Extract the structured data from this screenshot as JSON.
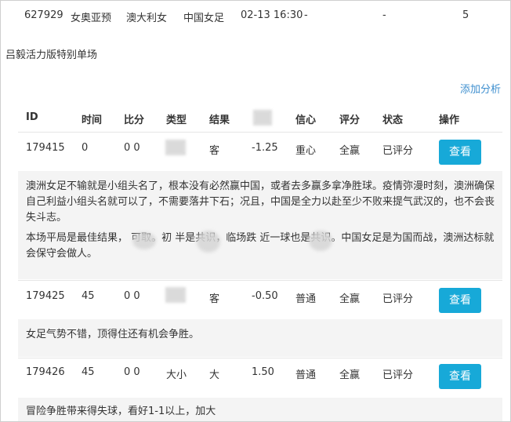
{
  "match": {
    "id": "627929",
    "league": "女奥亚预",
    "home": "澳大利女",
    "away": "中国女足",
    "time": "02-13 16:30",
    "dash1": "-",
    "dash2": "-",
    "count": "5"
  },
  "section_title": "吕毅活力版特别单场",
  "add_analysis": "添加分析",
  "table": {
    "headers": [
      "ID",
      "时间",
      "比分",
      "类型",
      "结果",
      "",
      "信心",
      "评分",
      "状态",
      "操作"
    ],
    "rows": [
      {
        "id": "179415",
        "time": "0",
        "score": "0 0",
        "type": "",
        "result": "客",
        "handicap": "-1.25",
        "confidence": "重心",
        "rating": "全赢",
        "status": "已评分",
        "action": "查看",
        "note": [
          "澳洲女足不输就是小组头名了，根本没有必然赢中国，或者去多赢多拿净胜球。疫情弥漫时刻，澳洲确保自己利益小组头名就可以了，不需要落井下石；况且，中国是全力以赴至少不败来提气武汉的，也不会丧失斗志。",
          "本场平局是最佳结果，    可取。初      半是共识，临场跌      近一球也是共识。中国女足是为国而战，澳洲达标就会保守会做人。"
        ]
      },
      {
        "id": "179425",
        "time": "45",
        "score": "0 0",
        "type": "",
        "result": "客",
        "handicap": "-0.50",
        "confidence": "普通",
        "rating": "全赢",
        "status": "已评分",
        "action": "查看",
        "note": [
          "女足气势不错，顶得住还有机会争胜。"
        ]
      },
      {
        "id": "179426",
        "time": "45",
        "score": "0 0",
        "type": "大小",
        "result": "大",
        "handicap": "1.50",
        "confidence": "普通",
        "rating": "全赢",
        "status": "已评分",
        "action": "查看",
        "note": [
          "冒险争胜带来得失球，看好1-1以上，加大"
        ]
      }
    ]
  },
  "colors": {
    "link": "#3e8fcf",
    "button": "#17a9d8",
    "note_bg": "#f4f4f4"
  }
}
